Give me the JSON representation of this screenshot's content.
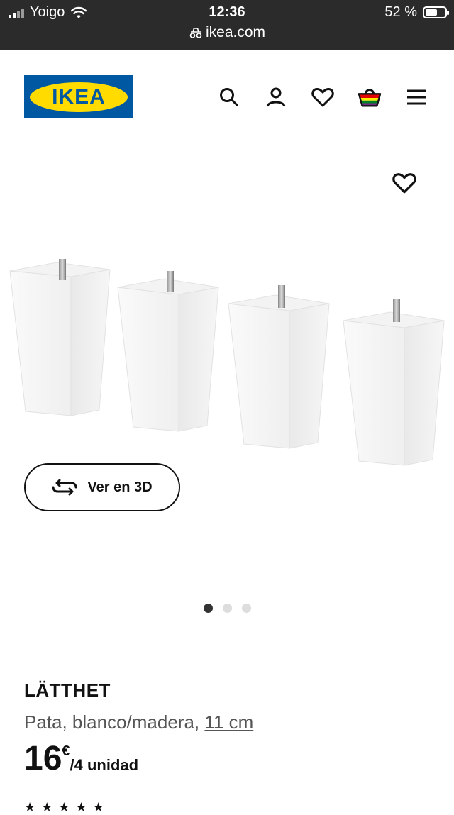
{
  "status_bar": {
    "carrier": "Yoigo",
    "time": "12:36",
    "battery": "52 %",
    "url": "ikea.com"
  },
  "header": {
    "logo_text": "IKEA",
    "icons": [
      "search-icon",
      "user-icon",
      "heart-icon",
      "basket-icon",
      "menu-icon"
    ]
  },
  "gallery": {
    "view3d_label": "Ver en 3D",
    "dots_total": 3,
    "active_dot": 1
  },
  "product": {
    "name": "LÄTTHET",
    "description": "Pata, blanco/madera, ",
    "size_link": "11 cm",
    "price_int": "16",
    "currency": "€",
    "unit": "/4 unidad"
  },
  "colors": {
    "ikea_blue": "#0058a3",
    "ikea_yellow": "#ffdb00",
    "status_bar_bg": "#2b2b2b"
  }
}
